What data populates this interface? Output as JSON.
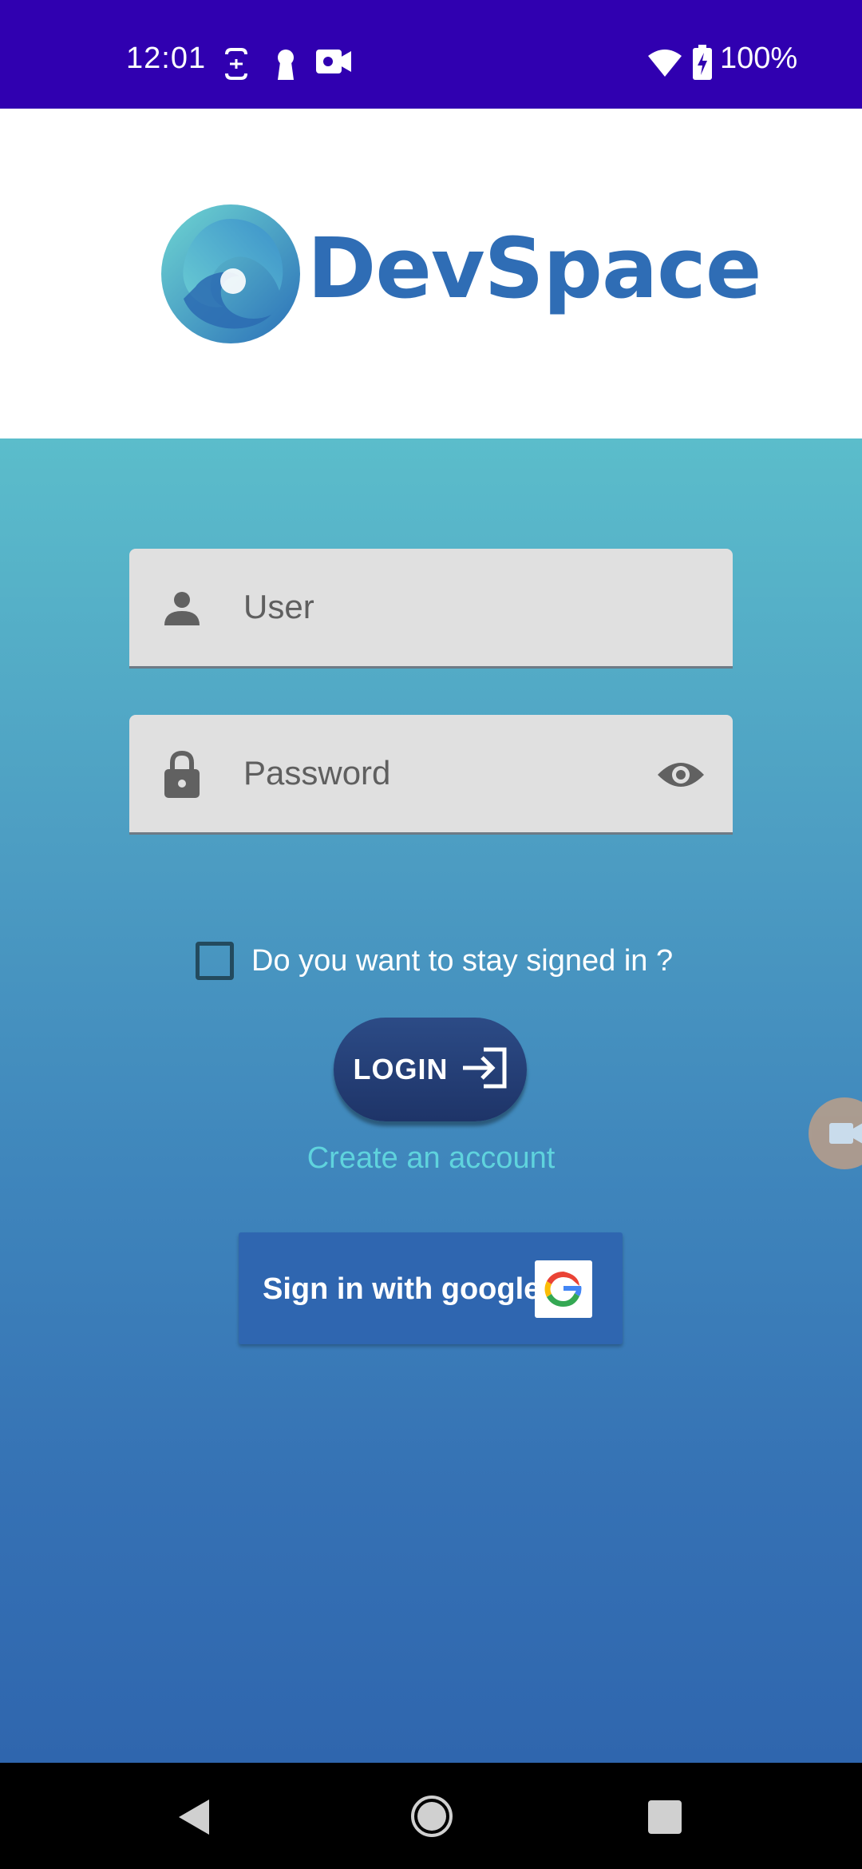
{
  "status_bar": {
    "time": "12:01",
    "battery": "100%"
  },
  "logo": {
    "text": "DevSpace"
  },
  "form": {
    "user_placeholder": "User",
    "password_placeholder": "Password",
    "stay_signed_in": "Do you want to stay signed in ?",
    "stay_signed_in_checked": false
  },
  "actions": {
    "login": "LOGIN",
    "create_account": "Create an account",
    "google": "Sign in with google"
  },
  "colors": {
    "status_bar": "#3000B0",
    "brand": "#2F6DB5",
    "login_button": "#233D73",
    "link": "#5FD3DD",
    "google_button": "#2F66B0"
  },
  "icons": [
    "face-unlock-icon",
    "keyhole-icon",
    "video-camera-icon",
    "wifi-icon",
    "battery-charging-icon",
    "person-icon",
    "lock-icon",
    "eye-icon",
    "login-arrow-icon",
    "google-g-icon",
    "back-icon",
    "home-icon",
    "recents-icon"
  ]
}
